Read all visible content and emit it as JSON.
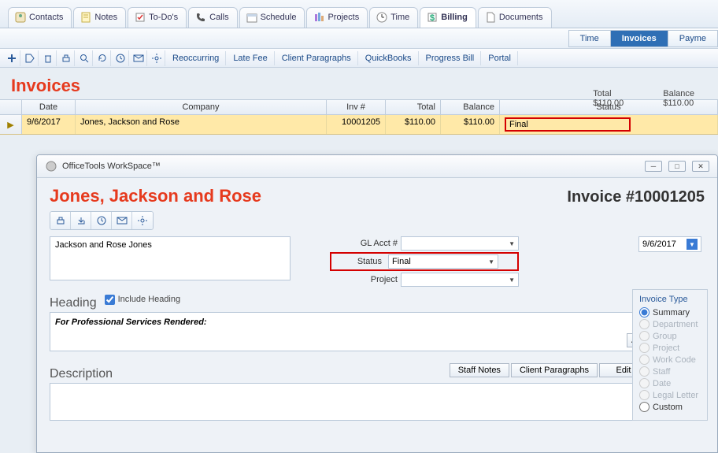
{
  "tabs": {
    "contacts": "Contacts",
    "notes": "Notes",
    "todos": "To-Do's",
    "calls": "Calls",
    "schedule": "Schedule",
    "projects": "Projects",
    "time": "Time",
    "billing": "Billing",
    "documents": "Documents"
  },
  "subbar": {
    "time": "Time",
    "invoices": "Invoices",
    "payme": "Payme"
  },
  "toolbar_text": {
    "reoccurring": "Reoccurring",
    "late_fee": "Late Fee",
    "client_paragraphs": "Client Paragraphs",
    "quickbooks": "QuickBooks",
    "progress_bill": "Progress Bill",
    "portal": "Portal"
  },
  "page_title": "Invoices",
  "totals": {
    "total_label": "Total",
    "total_value": "$110.00",
    "balance_label": "Balance",
    "balance_value": "$110.00"
  },
  "grid": {
    "headers": {
      "date": "Date",
      "company": "Company",
      "inv": "Inv #",
      "total": "Total",
      "balance": "Balance",
      "status": "Status"
    },
    "rows": [
      {
        "date": "9/6/2017",
        "company": "Jones, Jackson and Rose",
        "inv": "10001205",
        "total": "$110.00",
        "balance": "$110.00",
        "status": "Final"
      }
    ]
  },
  "modal": {
    "title": "OfficeTools WorkSpace™",
    "company_name": "Jones, Jackson and Rose",
    "invoice_label": "Invoice #10001205",
    "client_name": "Jackson and Rose Jones",
    "fields": {
      "gl_acct_label": "GL Acct #",
      "gl_acct_value": "",
      "status_label": "Status",
      "status_value": "Final",
      "project_label": "Project",
      "project_value": ""
    },
    "date_value": "9/6/2017",
    "heading_label": "Heading",
    "include_heading_label": "Include Heading",
    "heading_text": "For Professional Services Rendered:",
    "description_label": "Description",
    "buttons": {
      "staff_notes": "Staff Notes",
      "client_paragraphs": "Client Paragraphs",
      "edit": "Edit"
    },
    "invoice_type": {
      "title": "Invoice Type",
      "options": {
        "summary": "Summary",
        "department": "Department",
        "group": "Group",
        "project": "Project",
        "work_code": "Work Code",
        "staff": "Staff",
        "date": "Date",
        "legal_letter": "Legal Letter",
        "custom": "Custom"
      }
    }
  }
}
